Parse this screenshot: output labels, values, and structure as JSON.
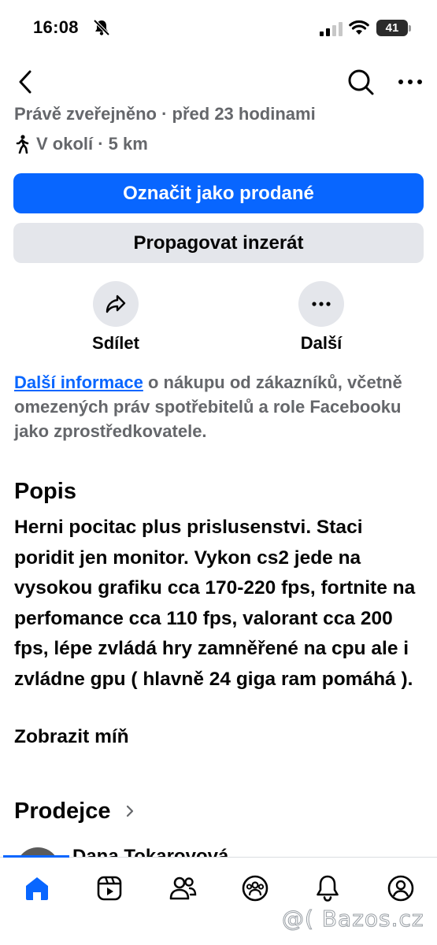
{
  "status_bar": {
    "time": "16:08",
    "battery": "41"
  },
  "listing": {
    "listed_time": "Právě zveřejněno · před 23 hodinami",
    "location": "V okolí · 5 km"
  },
  "buttons": {
    "mark_sold": "Označit jako prodané",
    "promote": "Propagovat inzerát"
  },
  "actions": {
    "share": "Sdílet",
    "more": "Další"
  },
  "info": {
    "link": "Další informace",
    "text": " o nákupu od zákazníků, včetně omezených práv spotřebitelů a role Facebooku jako zprostředkovatele."
  },
  "description": {
    "title": "Popis",
    "body": "Herni pocitac plus prislusenstvi. Staci poridit jen monitor. Vykon cs2 jede na vysokou grafiku cca 170-220 fps, fortnite na perfomance cca 110 fps, valorant cca 200 fps, lépe zvládá hry zamněřené na cpu ale i zvládne gpu ( hlavně 24 giga ram pomáhá ).",
    "show_less": "Zobrazit míň"
  },
  "seller": {
    "title": "Prodejce",
    "name": "Dana Tokarovová"
  },
  "tabs": [
    {
      "icon": "home-icon",
      "active": true
    },
    {
      "icon": "video-icon",
      "active": false
    },
    {
      "icon": "friends-icon",
      "active": false
    },
    {
      "icon": "groups-icon",
      "active": false
    },
    {
      "icon": "notifications-icon",
      "active": false
    },
    {
      "icon": "profile-icon",
      "active": false
    }
  ],
  "watermark": "@( Bazos.cz",
  "colors": {
    "accent": "#0866ff",
    "secondary_button": "#e4e6eb",
    "muted_text": "#65676b"
  }
}
